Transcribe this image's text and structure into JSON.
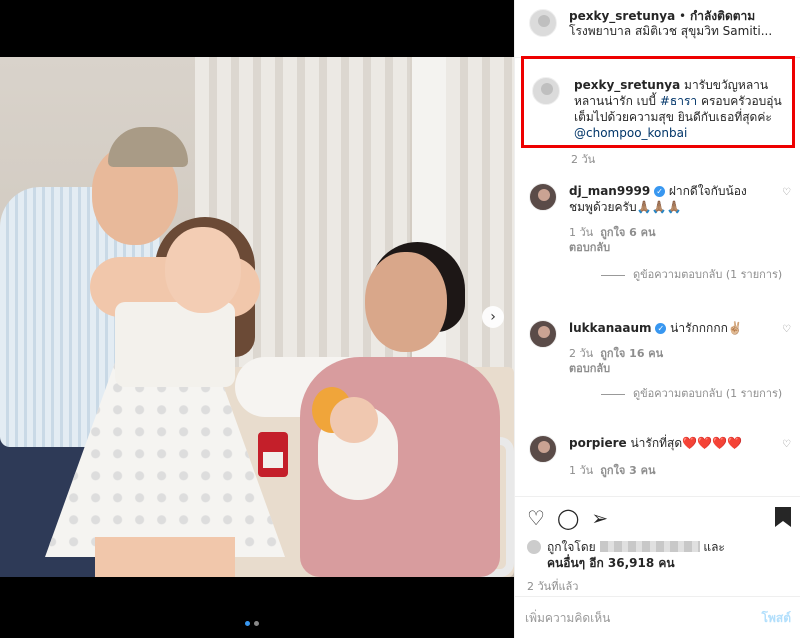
{
  "header": {
    "username": "pexky_sretunya",
    "separator": " • ",
    "follow_label": "กำลังติดตาม",
    "location": "โรงพยาบาล สมิติเวช สุขุมวิท Samiti..."
  },
  "caption": {
    "username": "pexky_sretunya",
    "text_1": " มารับขวัญหลาน หลานน่ารัก เบบี้ ",
    "hashtag": "#ธารา",
    "text_2": " ครอบครัวอบอุ่นเต็มไปด้วยความสุข ยินดีกับเธอที่สุดค่ะ ",
    "mention": "@chompoo_konbai",
    "time": "2 วัน"
  },
  "comments": [
    {
      "username": "dj_man9999",
      "verified": true,
      "text": " ฝากดีใจกับน้องชมพูด้วยครับ🙏🏽🙏🏽🙏🏽",
      "time": "1 วัน",
      "likes": "ถูกใจ 6 คน",
      "reply_label": "ตอบกลับ",
      "view_replies": "ดูข้อความตอบกลับ (1 รายการ)"
    },
    {
      "username": "lukkanaaum",
      "verified": true,
      "text": " น่ารักกกกก✌🏼",
      "time": "2 วัน",
      "likes": "ถูกใจ 16 คน",
      "reply_label": "ตอบกลับ",
      "view_replies": "ดูข้อความตอบกลับ (1 รายการ)"
    },
    {
      "username": "porpiere",
      "verified": false,
      "text": " น่ารักที่สุด❤️❤️❤️❤️",
      "time": "1 วัน",
      "likes": "ถูกใจ 3 คน"
    }
  ],
  "actions": {
    "icons": [
      "heart-icon",
      "comment-icon",
      "share-icon",
      "bookmark-icon"
    ],
    "liked_by_prefix": "ถูกใจโดย",
    "liked_by_suffix": " และ",
    "others_text": "คนอื่นๆ อีก 36,918 คน",
    "posted_time": "2 วันที่แล้ว"
  },
  "add_comment": {
    "placeholder": "เพิ่มความคิดเห็น",
    "post_label": "โพสต์"
  },
  "colors": {
    "highlight_border": "#ee0000",
    "link_blue": "#003569",
    "accent_blue": "#3897f0"
  }
}
